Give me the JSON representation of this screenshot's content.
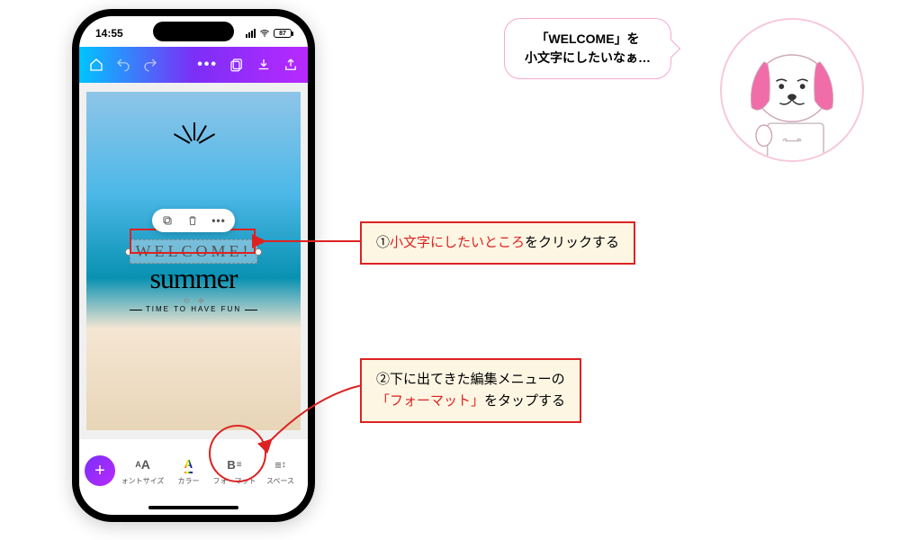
{
  "status": {
    "time": "14:55",
    "battery": "87"
  },
  "design": {
    "selected_text": "WELCOME!",
    "heading": "summer",
    "tagline": "TIME TO HAVE FUN"
  },
  "bottom_menu": {
    "items": [
      {
        "icon": "AA",
        "label": "ォントサイズ"
      },
      {
        "icon": "A",
        "label": "カラー"
      },
      {
        "icon": "B≡",
        "label": "フォーマット"
      },
      {
        "icon": "≡↕",
        "label": "スペース"
      }
    ]
  },
  "bubble": {
    "line1": "「WELCOME」を",
    "line2": "小文字にしたいなぁ…"
  },
  "callouts": {
    "c1_num": "①",
    "c1_red": "小文字にしたいところ",
    "c1_tail": "をクリックする",
    "c2_num": "②",
    "c2_l1": "下に出てきた編集メニューの",
    "c2_red": "「フォーマット」",
    "c2_tail": "をタップする"
  }
}
